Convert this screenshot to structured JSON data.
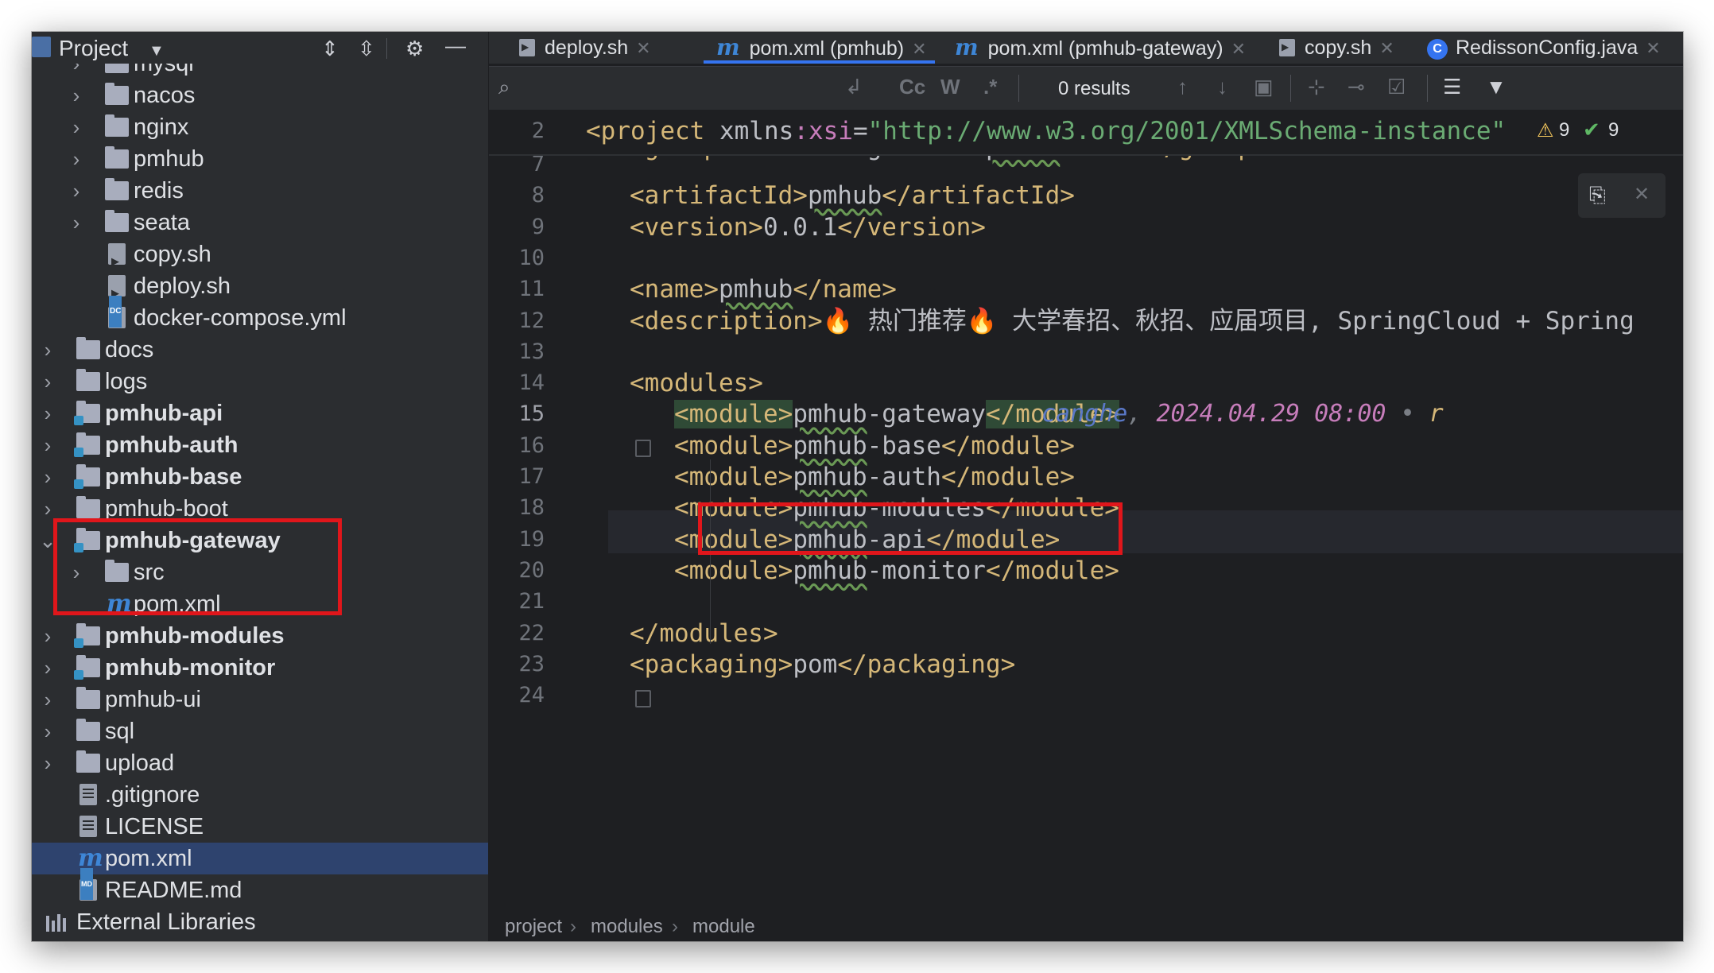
{
  "project_panel": {
    "title": "Project",
    "tree": [
      {
        "label": "mysql",
        "kind": "folder",
        "depth": 1,
        "expandable": true
      },
      {
        "label": "nacos",
        "kind": "folder",
        "depth": 1,
        "expandable": true
      },
      {
        "label": "nginx",
        "kind": "folder",
        "depth": 1,
        "expandable": true
      },
      {
        "label": "pmhub",
        "kind": "folder",
        "depth": 1,
        "expandable": true
      },
      {
        "label": "redis",
        "kind": "folder",
        "depth": 1,
        "expandable": true
      },
      {
        "label": "seata",
        "kind": "folder",
        "depth": 1,
        "expandable": true
      },
      {
        "label": "copy.sh",
        "kind": "sh",
        "depth": 1
      },
      {
        "label": "deploy.sh",
        "kind": "sh",
        "depth": 1
      },
      {
        "label": "docker-compose.yml",
        "kind": "dc",
        "depth": 1
      },
      {
        "label": "docs",
        "kind": "folder",
        "depth": 0,
        "expandable": true
      },
      {
        "label": "logs",
        "kind": "folder",
        "depth": 0,
        "expandable": true
      },
      {
        "label": "pmhub-api",
        "kind": "module",
        "depth": 0,
        "expandable": true,
        "bold": true
      },
      {
        "label": "pmhub-auth",
        "kind": "module",
        "depth": 0,
        "expandable": true,
        "bold": true
      },
      {
        "label": "pmhub-base",
        "kind": "module",
        "depth": 0,
        "expandable": true,
        "bold": true
      },
      {
        "label": "pmhub-boot",
        "kind": "folder",
        "depth": 0,
        "expandable": true
      },
      {
        "label": "pmhub-gateway",
        "kind": "module",
        "depth": 0,
        "expandable": true,
        "expanded": true,
        "bold": true
      },
      {
        "label": "src",
        "kind": "folder",
        "depth": 1,
        "expandable": true
      },
      {
        "label": "pom.xml",
        "kind": "maven",
        "depth": 1
      },
      {
        "label": "pmhub-modules",
        "kind": "module",
        "depth": 0,
        "expandable": true,
        "bold": true
      },
      {
        "label": "pmhub-monitor",
        "kind": "module",
        "depth": 0,
        "expandable": true,
        "bold": true
      },
      {
        "label": "pmhub-ui",
        "kind": "folder",
        "depth": 0,
        "expandable": true
      },
      {
        "label": "sql",
        "kind": "folder",
        "depth": 0,
        "expandable": true
      },
      {
        "label": "upload",
        "kind": "folder",
        "depth": 0,
        "expandable": true
      },
      {
        "label": ".gitignore",
        "kind": "txt",
        "depth": 0
      },
      {
        "label": "LICENSE",
        "kind": "txt",
        "depth": 0
      },
      {
        "label": "pom.xml",
        "kind": "maven",
        "depth": 0,
        "selected": true
      },
      {
        "label": "README.md",
        "kind": "md",
        "depth": 0
      },
      {
        "label": "External Libraries",
        "kind": "lib",
        "depth": -1
      }
    ]
  },
  "tabs": [
    {
      "label": "deploy.sh",
      "icon": "shell-script-icon"
    },
    {
      "label": "pom.xml (pmhub)",
      "icon": "maven-icon",
      "active": true
    },
    {
      "label": "pom.xml (pmhub-gateway)",
      "icon": "maven-icon"
    },
    {
      "label": "copy.sh",
      "icon": "shell-script-icon"
    },
    {
      "label": "RedissonConfig.java",
      "icon": "java-class-icon"
    }
  ],
  "search": {
    "results": "0 results",
    "case_label": "Cc",
    "word_label": "W",
    "regex_label": ".*"
  },
  "inspections": {
    "warnings": "9",
    "ok": "9"
  },
  "editor": {
    "sticky_line_number": "2",
    "sticky": {
      "open": "<project ",
      "attr": "xmlns",
      "ns": ":xsi",
      "eq": "=",
      "value": "\"http://www.w3.org/2001/XMLSchema-instance\""
    },
    "lines": [
      {
        "n": "7",
        "text": "<groupId>com.laigeoffer.pmhub-cloud</groupId>"
      },
      {
        "n": "8",
        "text": "<artifactId>pmhub</artifactId>"
      },
      {
        "n": "9",
        "text": "<version>0.0.1</version>"
      },
      {
        "n": "10",
        "text": ""
      },
      {
        "n": "11",
        "text": "<name>pmhub</name>"
      },
      {
        "n": "12",
        "text": "<description>🔥 热门推荐🔥 大学春招、秋招、应届项目, SpringCloud + Spring"
      },
      {
        "n": "13",
        "text": ""
      },
      {
        "n": "14",
        "text": "<modules>"
      },
      {
        "n": "15",
        "text": "<module>pmhub-gateway</module>"
      },
      {
        "n": "16",
        "text": "<module>pmhub-base</module>"
      },
      {
        "n": "17",
        "text": "<module>pmhub-auth</module>"
      },
      {
        "n": "18",
        "text": "<module>pmhub-modules</module>"
      },
      {
        "n": "19",
        "text": "<module>pmhub-api</module>"
      },
      {
        "n": "20",
        "text": "<module>pmhub-monitor</module>"
      },
      {
        "n": "21",
        "text": ""
      },
      {
        "n": "22",
        "text": "</modules>"
      },
      {
        "n": "23",
        "text": "<packaging>pom</packaging>"
      },
      {
        "n": "24",
        "text": ""
      }
    ],
    "blame": {
      "author": "canghe",
      "sep": ",",
      "date": "2024.04.29 08:00",
      "dot": "•",
      "tail": "r"
    }
  },
  "breadcrumb": [
    "project",
    "modules",
    "module"
  ],
  "colors": {
    "highlight_box": "#e0161b",
    "selection": "#2e436e",
    "active_tab": "#3574f0"
  }
}
